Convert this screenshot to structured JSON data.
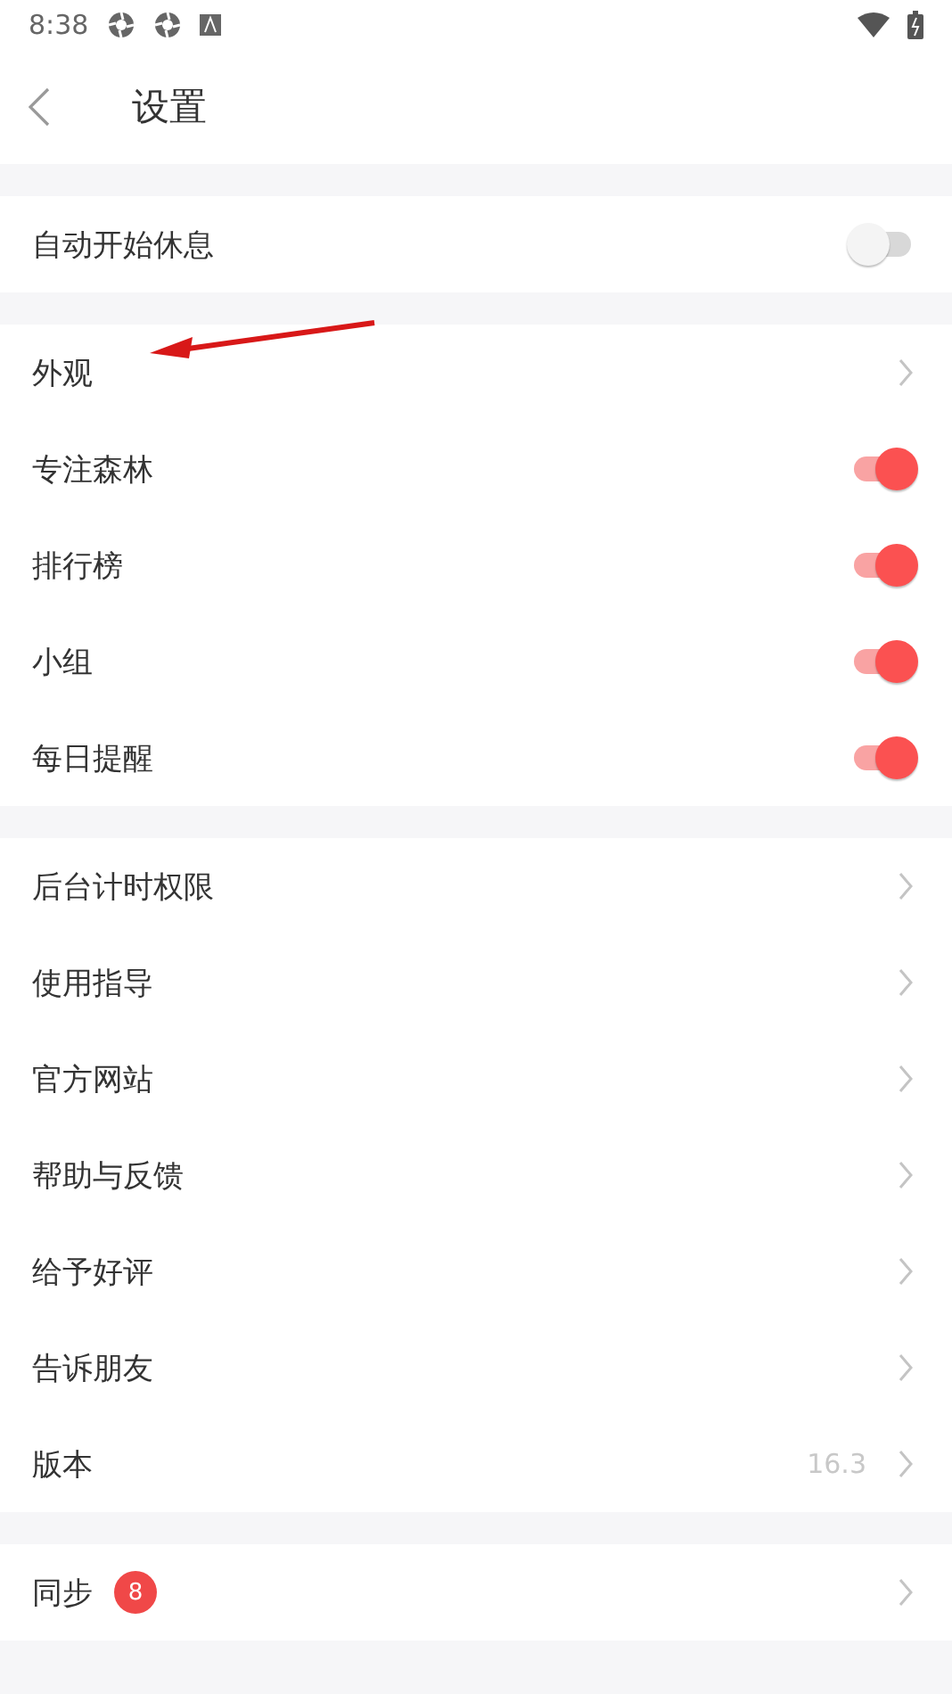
{
  "status_bar": {
    "time": "8:38"
  },
  "header": {
    "title": "设置"
  },
  "sections": [
    {
      "items": [
        {
          "kind": "toggle",
          "label": "自动开始休息",
          "on": false
        }
      ]
    },
    {
      "items": [
        {
          "kind": "link",
          "label": "外观"
        },
        {
          "kind": "toggle",
          "label": "专注森林",
          "on": true
        },
        {
          "kind": "toggle",
          "label": "排行榜",
          "on": true
        },
        {
          "kind": "toggle",
          "label": "小组",
          "on": true
        },
        {
          "kind": "toggle",
          "label": "每日提醒",
          "on": true
        }
      ]
    },
    {
      "items": [
        {
          "kind": "link",
          "label": "后台计时权限"
        },
        {
          "kind": "link",
          "label": "使用指导"
        },
        {
          "kind": "link",
          "label": "官方网站"
        },
        {
          "kind": "link",
          "label": "帮助与反馈"
        },
        {
          "kind": "link",
          "label": "给予好评"
        },
        {
          "kind": "link",
          "label": "告诉朋友"
        },
        {
          "kind": "link",
          "label": "版本",
          "value": "16.3"
        }
      ]
    },
    {
      "items": [
        {
          "kind": "link",
          "label": "同步",
          "badge": "8"
        }
      ]
    }
  ]
}
